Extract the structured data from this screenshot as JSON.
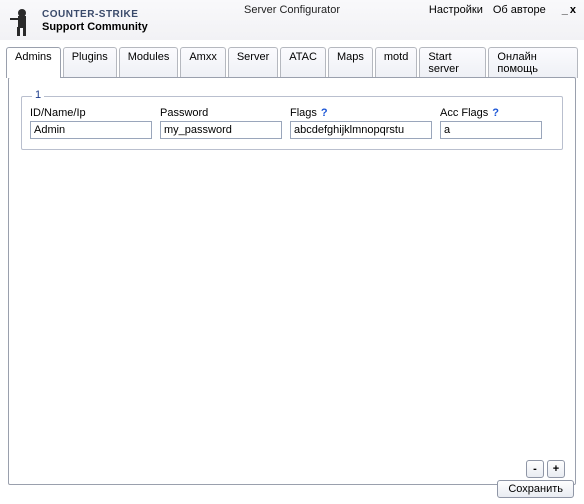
{
  "header": {
    "brand_line1": "COUNTER-STRIKE",
    "brand_line2": "Support Community",
    "title": "Server Configurator",
    "link_settings": "Настройки",
    "link_about": "Об авторе",
    "min_btn": "_",
    "close_btn": "x"
  },
  "tabs": [
    {
      "label": "Admins",
      "active": true
    },
    {
      "label": "Plugins",
      "active": false
    },
    {
      "label": "Modules",
      "active": false
    },
    {
      "label": "Amxx",
      "active": false
    },
    {
      "label": "Server",
      "active": false
    },
    {
      "label": "ATAC",
      "active": false
    },
    {
      "label": "Maps",
      "active": false
    },
    {
      "label": "motd",
      "active": false
    },
    {
      "label": "Start server",
      "active": false
    },
    {
      "label": "Онлайн помощь",
      "active": false
    }
  ],
  "group": {
    "number": "1",
    "labels": {
      "id": "ID/Name/Ip",
      "password": "Password",
      "flags": "Flags",
      "acc_flags": "Acc Flags",
      "help": "?"
    },
    "values": {
      "id": "Admin",
      "password": "my_password",
      "flags": "abcdefghijklmnopqrstu",
      "acc_flags": "a"
    }
  },
  "panel_buttons": {
    "minus": "-",
    "plus": "+"
  },
  "footer": {
    "save": "Сохранить"
  }
}
